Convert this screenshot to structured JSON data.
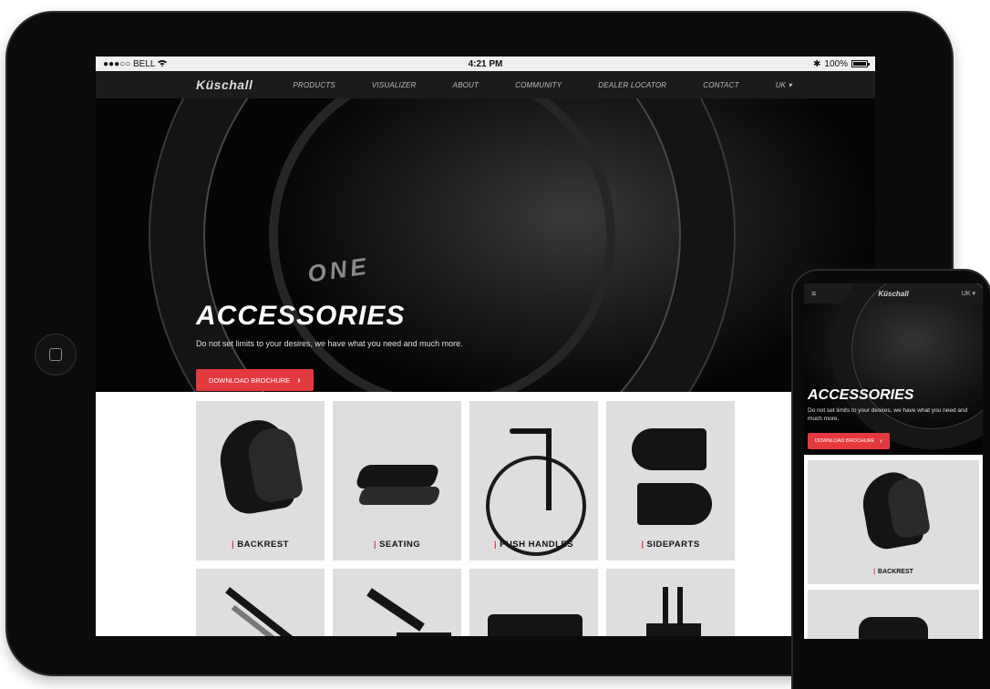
{
  "statusbar": {
    "carrier": "●●●○○ BELL",
    "wifi_icon": "wifi-icon",
    "time": "4:21 PM",
    "bluetooth": "✱",
    "battery": "100%"
  },
  "nav": {
    "logo": "Küschall",
    "items": [
      {
        "label": "PRODUCTS"
      },
      {
        "label": "VISUALIZER"
      },
      {
        "label": "ABOUT"
      },
      {
        "label": "COMMUNITY"
      },
      {
        "label": "DEALER LOCATOR"
      },
      {
        "label": "CONTACT"
      },
      {
        "label": "UK ▾"
      }
    ]
  },
  "hero": {
    "rim_text": "ONE",
    "title": "ACCESSORIES",
    "subtitle": "Do not set limits to your desires, we have what you need and much more.",
    "button": "DOWNLOAD BROCHURE",
    "button_chevron": "›"
  },
  "grid": {
    "tiles": [
      {
        "label": "BACKREST"
      },
      {
        "label": "SEATING"
      },
      {
        "label": "PUSH HANDLES"
      },
      {
        "label": "SIDEPARTS"
      }
    ]
  },
  "phone": {
    "menu": "≡",
    "logo": "Küschall",
    "lang": "UK ▾",
    "title": "ACCESSORIES",
    "subtitle": "Do not set limits to your desires, we have what you need and much more.",
    "button": "DOWNLOAD BROCHURE",
    "button_chevron": "›",
    "tile_label": "BACKREST"
  },
  "colors": {
    "accent": "#e43a3f",
    "nav_bg": "#1b1b1b",
    "tile_bg": "#dedede"
  }
}
